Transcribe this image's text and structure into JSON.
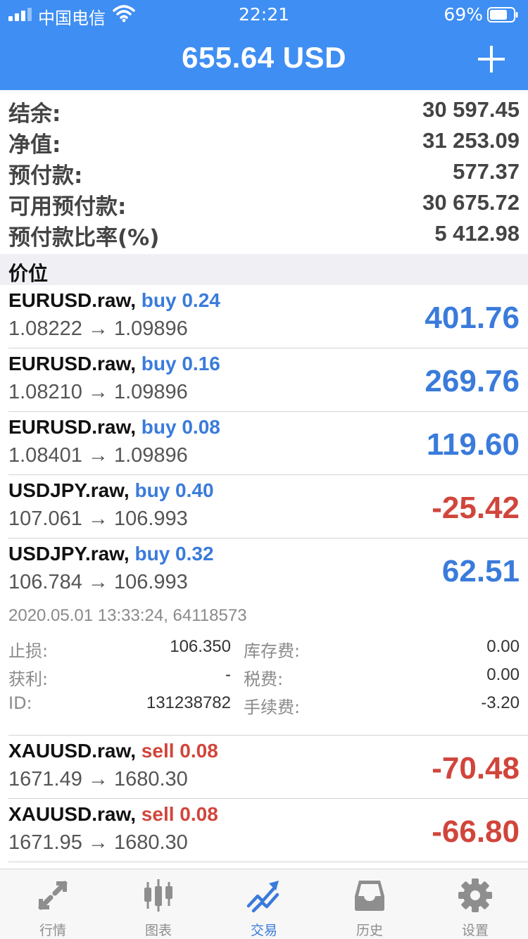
{
  "status_bar": {
    "carrier": "中国电信",
    "time": "22:21",
    "battery": "69%"
  },
  "header": {
    "title": "655.64 USD"
  },
  "summary": [
    {
      "label": "结余:",
      "value": "30 597.45"
    },
    {
      "label": "净值:",
      "value": "31 253.09"
    },
    {
      "label": "预付款:",
      "value": "577.37"
    },
    {
      "label": "可用预付款:",
      "value": "30 675.72"
    },
    {
      "label": "预付款比率(%)",
      "value": "5 412.98"
    }
  ],
  "section_title": "价位",
  "positions": [
    {
      "symbol": "EURUSD.raw,",
      "side": "buy 0.24",
      "prices": "1.08222 → 1.09896",
      "profit": "401.76",
      "tone": "blue"
    },
    {
      "symbol": "EURUSD.raw,",
      "side": "buy 0.16",
      "prices": "1.08210 → 1.09896",
      "profit": "269.76",
      "tone": "blue"
    },
    {
      "symbol": "EURUSD.raw,",
      "side": "buy 0.08",
      "prices": "1.08401 → 1.09896",
      "profit": "119.60",
      "tone": "blue"
    },
    {
      "symbol": "USDJPY.raw,",
      "side": "buy 0.40",
      "prices": "107.061 → 106.993",
      "profit": "-25.42",
      "tone": "red"
    },
    {
      "symbol": "USDJPY.raw,",
      "side": "buy 0.32",
      "prices": "106.784 → 106.993",
      "profit": "62.51",
      "tone": "blue"
    }
  ],
  "details": {
    "timestamp": "2020.05.01 13:33:24, 64118573",
    "rows": [
      {
        "l1": "止损:",
        "v1": "106.350",
        "l2": "库存费:",
        "v2": "0.00"
      },
      {
        "l1": "获利:",
        "v1": "-",
        "l2": "税费:",
        "v2": "0.00"
      },
      {
        "l1": "ID:",
        "v1": "131238782",
        "l2": "手续费:",
        "v2": "-3.20"
      }
    ]
  },
  "positions_after": [
    {
      "symbol": "XAUUSD.raw,",
      "side": "sell 0.08",
      "prices": "1671.49 → 1680.30",
      "profit": "-70.48",
      "tone": "red"
    },
    {
      "symbol": "XAUUSD.raw,",
      "side": "sell 0.08",
      "prices": "1671.95 → 1680.30",
      "profit": "-66.80",
      "tone": "red"
    }
  ],
  "tabs": [
    {
      "label": "行情",
      "icon": "quotes-arrows-icon",
      "active": false
    },
    {
      "label": "图表",
      "icon": "candlestick-chart-icon",
      "active": false
    },
    {
      "label": "交易",
      "icon": "trade-trend-icon",
      "active": true
    },
    {
      "label": "历史",
      "icon": "history-inbox-icon",
      "active": false
    },
    {
      "label": "设置",
      "icon": "gear-icon",
      "active": false
    }
  ],
  "colors": {
    "header": "#3f8ef3",
    "profit_blue": "#3a7bdb",
    "loss_red": "#d1453b",
    "tab_active": "#3a7bdb",
    "tab_inactive": "#8e8e8e"
  }
}
